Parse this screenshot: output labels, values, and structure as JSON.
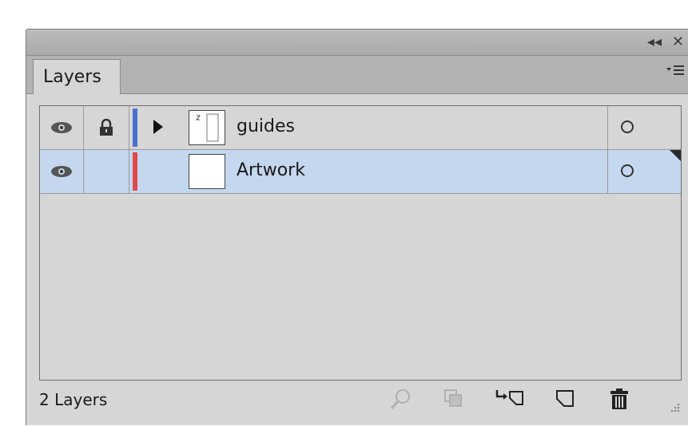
{
  "panel": {
    "title_controls": {
      "collapse": "◂◂",
      "close": "✕"
    },
    "tab_label": "Layers",
    "menu_icon": "panel-menu-icon"
  },
  "layers": [
    {
      "name": "guides",
      "visible": true,
      "locked": true,
      "color": "#4a6fd0",
      "expandable": true,
      "selected": false
    },
    {
      "name": "Artwork",
      "visible": true,
      "locked": false,
      "color": "#e0484a",
      "expandable": false,
      "selected": true
    }
  ],
  "footer": {
    "count_label": "2 Layers",
    "icons": [
      "locate-object-icon",
      "make-clipping-mask-icon",
      "create-sublayer-icon",
      "create-layer-icon",
      "delete-icon"
    ]
  }
}
